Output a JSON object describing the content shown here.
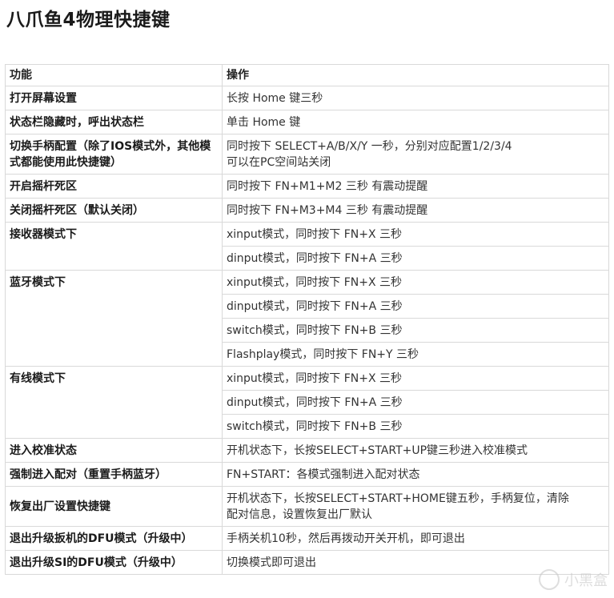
{
  "title": "八爪鱼4物理快捷键",
  "table": {
    "headers": [
      "功能",
      "操作"
    ],
    "rows": [
      {
        "func": "打开屏幕设置",
        "ops": [
          [
            "长按 Home 键三秒"
          ]
        ]
      },
      {
        "func": "状态栏隐藏时，呼出状态栏",
        "ops": [
          [
            "单击 Home 键"
          ]
        ]
      },
      {
        "func": "切换手柄配置（除了IOS模式外，其他模式都能使用此快捷键）",
        "ops": [
          [
            "同时按下 SELECT+A/B/X/Y 一秒，分别对应配置1/2/3/4",
            "可以在PC空间站关闭"
          ]
        ]
      },
      {
        "func": "开启摇杆死区",
        "ops": [
          [
            "同时按下 FN+M1+M2 三秒 有震动提醒"
          ]
        ]
      },
      {
        "func": "关闭摇杆死区（默认关闭）",
        "ops": [
          [
            "同时按下 FN+M3+M4 三秒 有震动提醒"
          ]
        ]
      },
      {
        "func": "接收器模式下",
        "ops": [
          [
            "xinput模式，同时按下 FN+X 三秒"
          ],
          [
            "dinput模式，同时按下 FN+A 三秒"
          ]
        ]
      },
      {
        "func": "蓝牙模式下",
        "ops": [
          [
            "xinput模式，同时按下 FN+X 三秒"
          ],
          [
            "dinput模式，同时按下 FN+A 三秒"
          ],
          [
            "switch模式，同时按下 FN+B 三秒"
          ],
          [
            "Flashplay模式，同时按下 FN+Y 三秒"
          ]
        ]
      },
      {
        "func": "有线模式下",
        "ops": [
          [
            "xinput模式，同时按下 FN+X 三秒"
          ],
          [
            "dinput模式，同时按下 FN+A 三秒"
          ],
          [
            "switch模式，同时按下 FN+B 三秒"
          ]
        ]
      },
      {
        "func": "进入校准状态",
        "ops": [
          [
            "开机状态下，长按SELECT+START+UP键三秒进入校准模式"
          ]
        ]
      },
      {
        "func": "强制进入配对（重置手柄蓝牙）",
        "ops": [
          [
            "FN+START：各模式强制进入配对状态"
          ]
        ]
      },
      {
        "func": "恢复出厂设置快捷键",
        "ops": [
          [
            "开机状态下，长按SELECT+START+HOME键五秒，手柄复位，清除",
            "配对信息，设置恢复出厂默认"
          ]
        ]
      },
      {
        "func": "退出升级扳机的DFU模式（升级中）",
        "ops": [
          [
            "手柄关机10秒，然后再拨动开关开机，即可退出"
          ]
        ]
      },
      {
        "func": "退出升级SI的DFU模式（升级中）",
        "ops": [
          [
            "切换模式即可退出"
          ]
        ]
      }
    ]
  },
  "watermark_text": "小黑盒",
  "icons": {
    "logo": "xiaoheihe-logo-icon"
  }
}
